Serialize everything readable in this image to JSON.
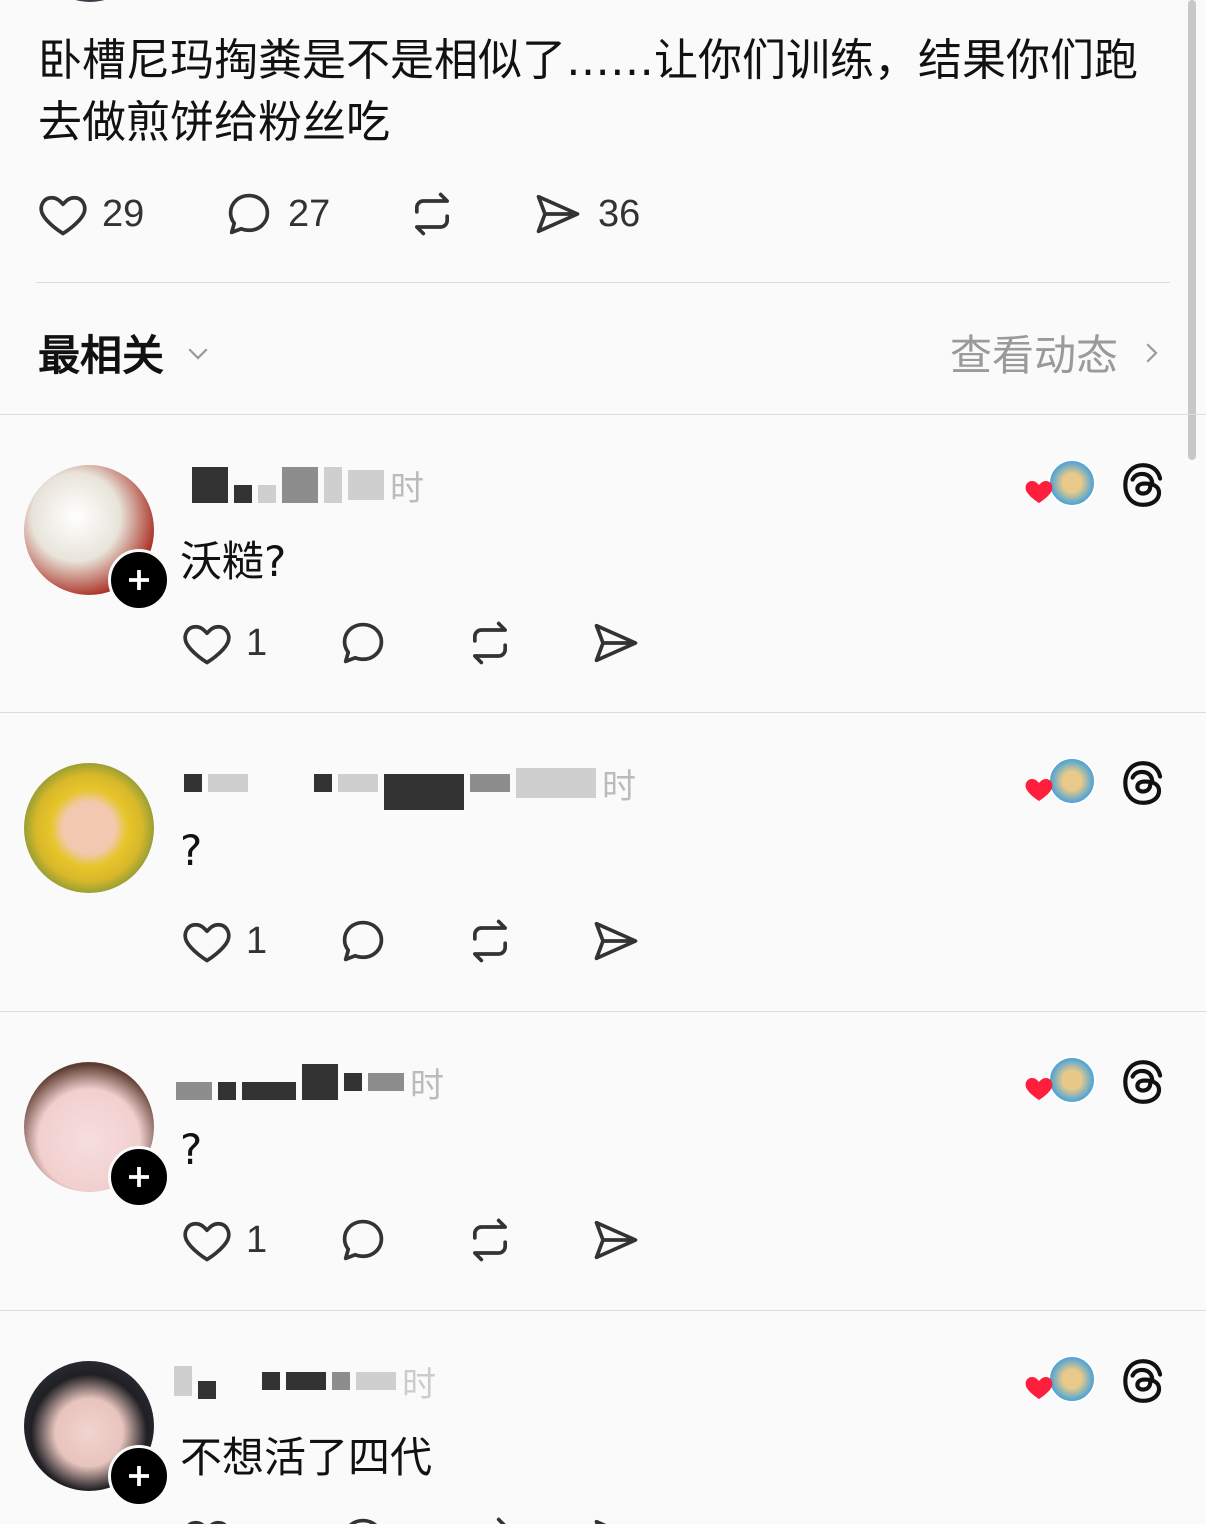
{
  "post": {
    "text": "卧槽尼玛掏粪是不是相似了……让你们训练，结果你们跑去做煎饼给粉丝吃",
    "likes": "29",
    "comments": "27",
    "shares": "36"
  },
  "sort": {
    "label": "最相关",
    "view_activity": "查看动态"
  },
  "comments": [
    {
      "text": "沃糙?",
      "likes": "1",
      "time_suffix": "时"
    },
    {
      "text": "?",
      "likes": "1",
      "time_suffix": "时"
    },
    {
      "text": "?",
      "likes": "1",
      "time_suffix": "时"
    },
    {
      "text": "不想活了四代",
      "likes": "",
      "time_suffix": "时"
    }
  ],
  "colors": {
    "accent_red": "#ff1f3d",
    "text": "#111111",
    "muted": "#9a9a9a"
  }
}
